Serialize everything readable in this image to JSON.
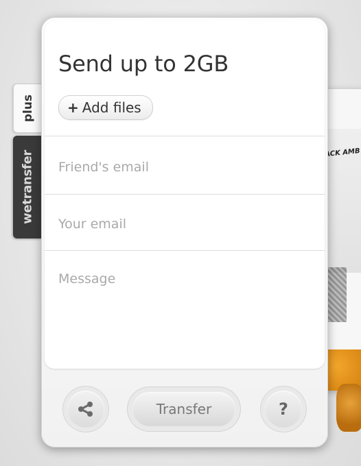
{
  "side_tabs": {
    "plus_label": "plus",
    "brand_label": "wetransfer"
  },
  "form": {
    "title": "Send up to 2GB",
    "add_files_label": "Add files",
    "add_files_icon": "plus-icon",
    "friend_email_placeholder": "Friend's email",
    "your_email_placeholder": "Your email",
    "message_placeholder": "Message"
  },
  "footer": {
    "share_icon": "share-icon",
    "transfer_label": "Transfer",
    "help_label": "?"
  },
  "background": {
    "poster_text": "LACK AMB"
  },
  "colors": {
    "brand_tab": "#3a3a3a",
    "text": "#333333",
    "placeholder": "#a9a9a9"
  }
}
